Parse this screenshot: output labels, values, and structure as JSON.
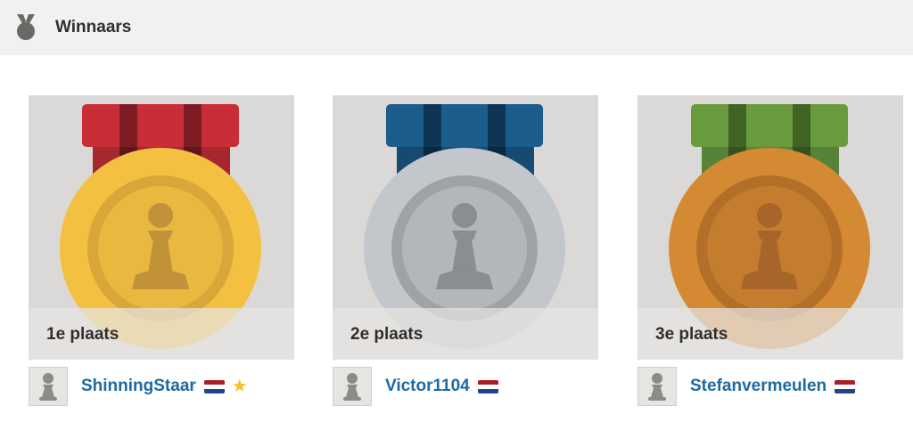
{
  "header": {
    "title": "Winnaars",
    "icon": "medal-icon"
  },
  "winners": [
    {
      "place_label": "1e plaats",
      "username": "ShinningStaar",
      "flag": "netherlands-flag-icon",
      "badge": "star-icon",
      "medal": "gold"
    },
    {
      "place_label": "2e plaats",
      "username": "Victor1104",
      "flag": "netherlands-flag-icon",
      "medal": "silver"
    },
    {
      "place_label": "3e plaats",
      "username": "Stefanvermeulen",
      "flag": "netherlands-flag-icon",
      "medal": "bronze"
    }
  ],
  "colors": {
    "gold": "#f3c042",
    "silver": "#c3c6ca",
    "bronze": "#d48a32",
    "ribbon_red": "#c92d36",
    "ribbon_blue": "#1b5d8c",
    "ribbon_green": "#6a9a3e",
    "link": "#1b6aa3"
  }
}
